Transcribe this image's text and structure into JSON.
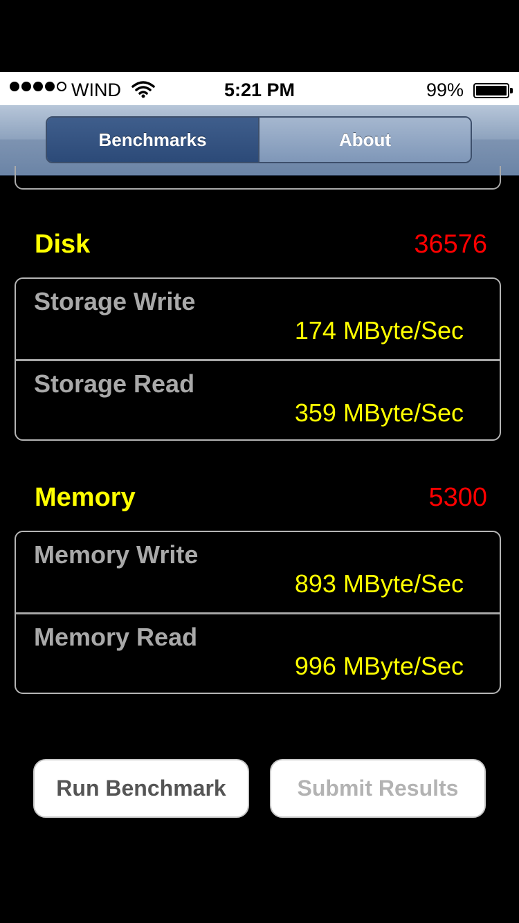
{
  "status_bar": {
    "carrier": "WIND",
    "time": "5:21 PM",
    "battery": "99%",
    "signal_bars_filled": 4,
    "signal_bars_total": 5
  },
  "nav": {
    "tabs": [
      {
        "label": "Benchmarks",
        "selected": true
      },
      {
        "label": "About",
        "selected": false
      }
    ]
  },
  "sections": {
    "disk": {
      "title": "Disk",
      "score": "36576",
      "rows": [
        {
          "label": "Storage Write",
          "value": "174 MByte/Sec"
        },
        {
          "label": "Storage Read",
          "value": "359 MByte/Sec"
        }
      ]
    },
    "memory": {
      "title": "Memory",
      "score": "5300",
      "rows": [
        {
          "label": "Memory Write",
          "value": "893 MByte/Sec"
        },
        {
          "label": "Memory Read",
          "value": "996 MByte/Sec"
        }
      ]
    }
  },
  "actions": {
    "run_label": "Run Benchmark",
    "submit_label": "Submit Results",
    "submit_enabled": false
  },
  "colors": {
    "section_title": "#ffff00",
    "score": "#ff0000",
    "value": "#ffff00",
    "label": "#a9a9a9"
  },
  "icons": {
    "wifi": "wifi-icon",
    "battery": "battery-icon",
    "signal": "signal-strength-icon"
  }
}
